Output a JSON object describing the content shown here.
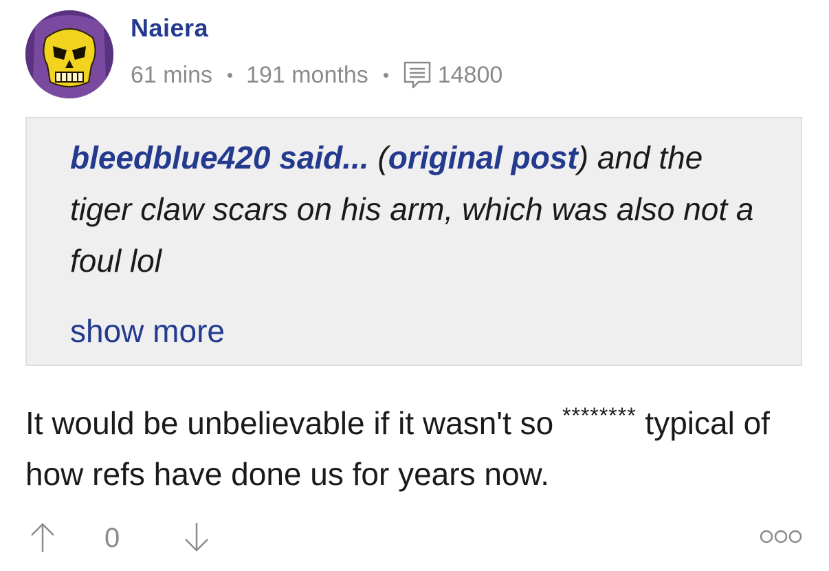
{
  "post": {
    "author": "Naiera",
    "avatar_icon": "skeletor-avatar",
    "meta": {
      "time_ago": "61 mins",
      "member_for": "191 months",
      "post_count": "14800"
    },
    "quote": {
      "author_said": "bleedblue420 said...",
      "open_paren": " (",
      "link_label": "original post",
      "close_rest": ") and the tiger claw scars on his arm, which was also not a foul lol",
      "show_more": "show more"
    },
    "body": {
      "text_before": "It would be unbelievable if it wasn't so ",
      "censored": "********",
      "text_after": " typical of how refs have done us for years now."
    },
    "actions": {
      "vote_count": "0",
      "upvote_icon": "arrow-up-icon",
      "downvote_icon": "arrow-down-icon",
      "more_icon": "more-options-icon"
    }
  },
  "colors": {
    "link_blue": "#233a8f",
    "muted_gray": "#8b8b8b",
    "quote_bg": "#efefef",
    "avatar_bg": "#6a3f8e",
    "skull_yellow": "#f2d31f"
  }
}
